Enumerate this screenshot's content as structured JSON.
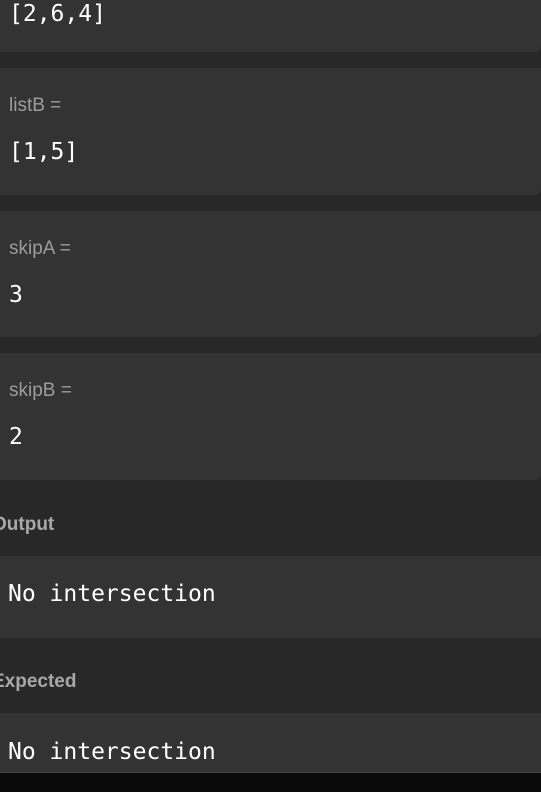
{
  "inputs": {
    "listA": {
      "value": "[2,6,4]"
    },
    "listB": {
      "label": "listB =",
      "value": "[1,5]"
    },
    "skipA": {
      "label": "skipA =",
      "value": "3"
    },
    "skipB": {
      "label": "skipB =",
      "value": "2"
    }
  },
  "output": {
    "heading": "Output",
    "value": "No intersection"
  },
  "expected": {
    "heading": "Expected",
    "value": "No intersection"
  },
  "colors": {
    "background": "#282828",
    "card": "#333333",
    "label": "#9c9c9c",
    "value_text": "#ffffff",
    "bottom_bar": "#0a0a0a"
  }
}
